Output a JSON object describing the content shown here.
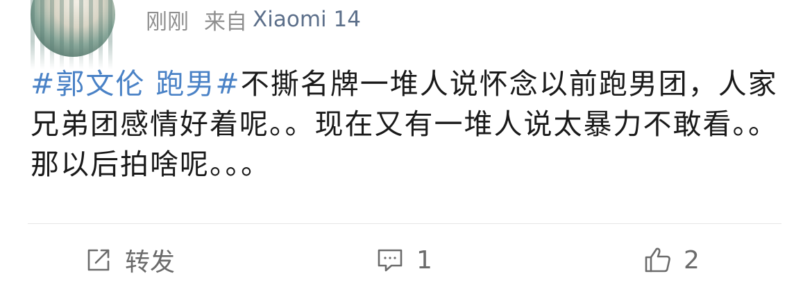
{
  "post": {
    "time": "刚刚",
    "from_label": "来自",
    "device": "Xiaomi 14",
    "topic": "#郭文伦 跑男#",
    "text": "不撕名牌一堆人说怀念以前跑男团，人家兄弟团感情好着呢。。现在又有一堆人说太暴力不敢看。。那以后拍啥呢。。。"
  },
  "actions": {
    "repost": {
      "icon": "share-icon",
      "label": "转发"
    },
    "comment": {
      "icon": "comment-icon",
      "count": "1"
    },
    "like": {
      "icon": "thumbs-up-icon",
      "count": "2"
    }
  },
  "colors": {
    "topic": "#4a82c6",
    "meta": "#8f8f8f",
    "device": "#5c6f8a",
    "action": "#6b6b6b",
    "divider": "#e6e6e6"
  }
}
